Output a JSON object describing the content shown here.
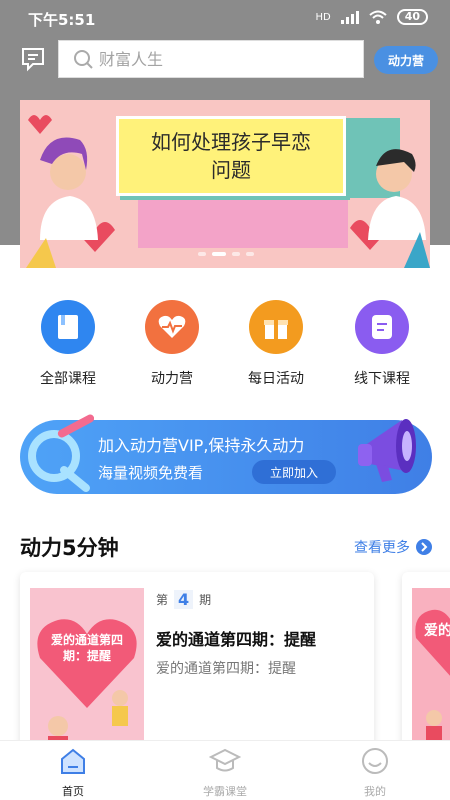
{
  "status": {
    "time": "下午5:51",
    "network": "HD",
    "battery": "40"
  },
  "header": {
    "search_placeholder": "财富人生",
    "camp_button": "动力营"
  },
  "banner": {
    "title_line1": "如何处理孩子早恋",
    "title_line2": "问题"
  },
  "quick_menu": [
    {
      "label": "全部课程",
      "icon": "book-icon",
      "color": "#2f86f0"
    },
    {
      "label": "动力营",
      "icon": "heartbeat-icon",
      "color": "#f2713f"
    },
    {
      "label": "每日活动",
      "icon": "gift-icon",
      "color": "#f39b1f"
    },
    {
      "label": "线下课程",
      "icon": "document-icon",
      "color": "#8a5cf0"
    }
  ],
  "vip": {
    "line1": "加入动力营VIP,保持永久动力",
    "line2": "海量视频免费看",
    "join_button": "立即加入"
  },
  "section": {
    "title": "动力5分钟",
    "more": "查看更多"
  },
  "card": {
    "issue_prefix": "第",
    "issue_number": "4",
    "issue_suffix": "期",
    "thumb_text": "爱的通道第四期：提醒",
    "title": "爱的通道第四期：提醒",
    "subtitle": "爱的通道第四期：提醒"
  },
  "card2": {
    "thumb_text": "爱的"
  },
  "tabbar": [
    {
      "label": "首页",
      "icon": "home-icon",
      "active": true
    },
    {
      "label": "学霸课堂",
      "icon": "graduation-cap-icon",
      "active": false
    },
    {
      "label": "我的",
      "icon": "smiley-icon",
      "active": false
    }
  ]
}
